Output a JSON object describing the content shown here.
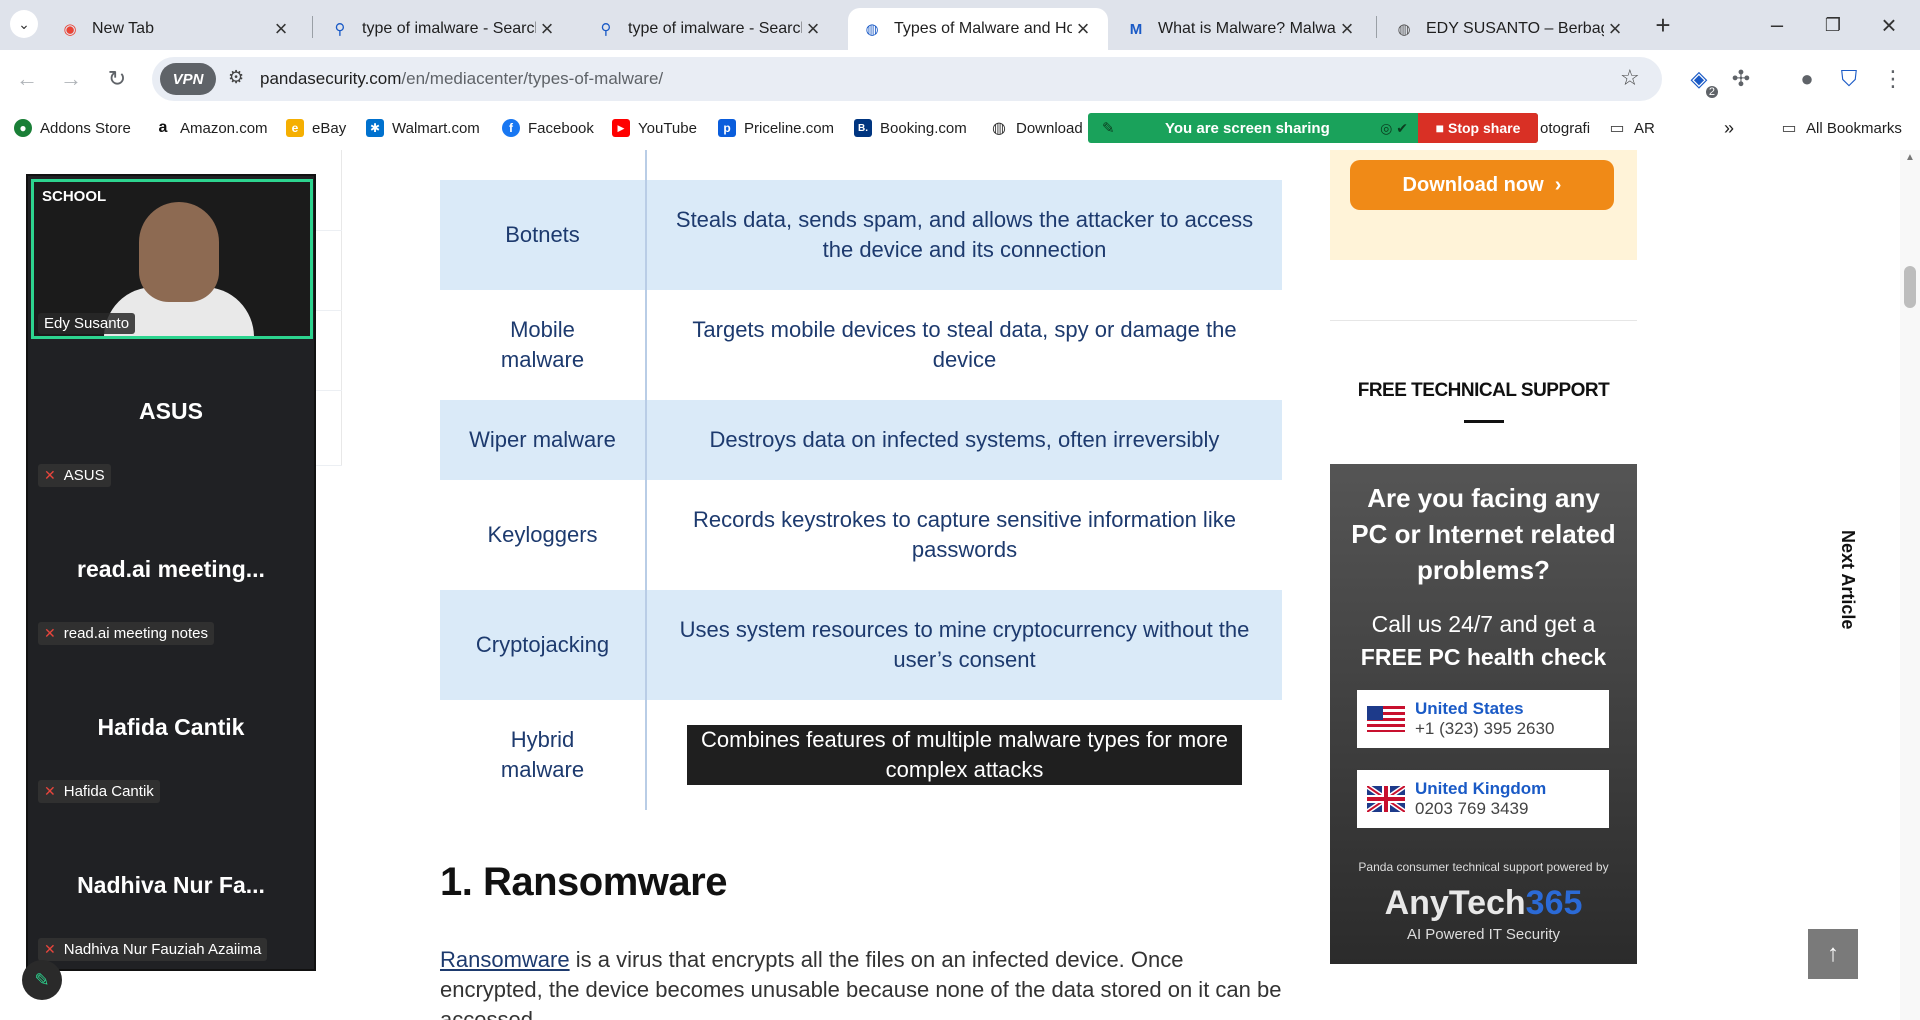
{
  "tabs": [
    {
      "title": "New Tab",
      "icon": "chrome-icon"
    },
    {
      "title": "type of imalware - Search",
      "icon": "search-icon"
    },
    {
      "title": "type of imalware - Search",
      "icon": "search-icon"
    },
    {
      "title": "Types of Malware and How",
      "icon": "panda-icon",
      "active": true
    },
    {
      "title": "What is Malware? Malware",
      "icon": "malwarebytes-icon"
    },
    {
      "title": "EDY SUSANTO – Berbagi P",
      "icon": "globe-icon"
    }
  ],
  "address": {
    "host": "pandasecurity.com",
    "path": "/en/mediacenter/types-of-malware/",
    "vpn_label": "VPN"
  },
  "extension_badge": "2",
  "bookmarks": [
    {
      "label": "Addons Store",
      "color": "#1a7f37",
      "glyph": "●"
    },
    {
      "label": "Amazon.com",
      "color": "#111111",
      "glyph": "a"
    },
    {
      "label": "eBay",
      "color": "#e53238",
      "glyph": "e"
    },
    {
      "label": "Walmart.com",
      "color": "#0071ce",
      "glyph": "✱"
    },
    {
      "label": "Facebook",
      "color": "#1877f2",
      "glyph": "f"
    },
    {
      "label": "YouTube",
      "color": "#ff0000",
      "glyph": "▶"
    },
    {
      "label": "Priceline.com",
      "color": "#0a5ddc",
      "glyph": "p"
    },
    {
      "label": "Booking.com",
      "color": "#003580",
      "glyph": "B."
    },
    {
      "label": "Download",
      "color": "#333333",
      "glyph": "◍"
    }
  ],
  "bookmarks_right": [
    "otografi",
    "AR"
  ],
  "all_bookmarks": "All Bookmarks",
  "screen_share": {
    "message": "You are screen sharing",
    "stop": "Stop share"
  },
  "meeting": {
    "presenter": "Edy Susanto",
    "logo": "SCHOOL",
    "participants": [
      {
        "tile": "ASUS",
        "tag": "ASUS"
      },
      {
        "tile": "read.ai  meeting...",
        "tag": "read.ai meeting notes"
      },
      {
        "tile": "Hafida  Cantik",
        "tag": "Hafida Cantik"
      },
      {
        "tile": "Nadhiva  Nur  Fa...",
        "tag": "Nadhiva Nur Fauziah Azaiima"
      }
    ]
  },
  "table": [
    {
      "type": "Botnets",
      "desc": "Steals data, sends spam, and allows the attacker to access the device and its connection"
    },
    {
      "type": "Mobile malware",
      "desc": "Targets mobile devices to steal data, spy or damage the device"
    },
    {
      "type": "Wiper malware",
      "desc": "Destroys data on infected systems, often irreversibly"
    },
    {
      "type": "Keyloggers",
      "desc": "Records keystrokes to capture sensitive information like passwords"
    },
    {
      "type": "Cryptojacking",
      "desc": "Uses system resources to mine cryptocurrency without the user’s consent"
    },
    {
      "type": "Hybrid malware",
      "desc": "Combines features of multiple malware types for more complex attacks"
    }
  ],
  "article": {
    "heading": "1. Ransomware",
    "link_word": "Ransomware",
    "paragraph": " is a virus that encrypts all the files on an infected device. Once encrypted, the device becomes unusable because none of the data stored on it can be accessed."
  },
  "sidebar": {
    "download": "Download now",
    "support_heading": "FREE TECHNICAL SUPPORT",
    "ad_question": "Are you facing any PC or Internet related problems?",
    "ad_call": "Call us 24/7 and get a",
    "ad_offer": "FREE PC health check",
    "countries": [
      {
        "name": "United States",
        "phone": "+1 (323) 395 2630"
      },
      {
        "name": "United Kingdom",
        "phone": "0203 769 3439"
      }
    ],
    "powered": "Panda consumer technical support powered by",
    "brand_a": "AnyTech",
    "brand_b": "365",
    "brand_tag": "AI Powered IT Security"
  },
  "next_article": "Next Article"
}
